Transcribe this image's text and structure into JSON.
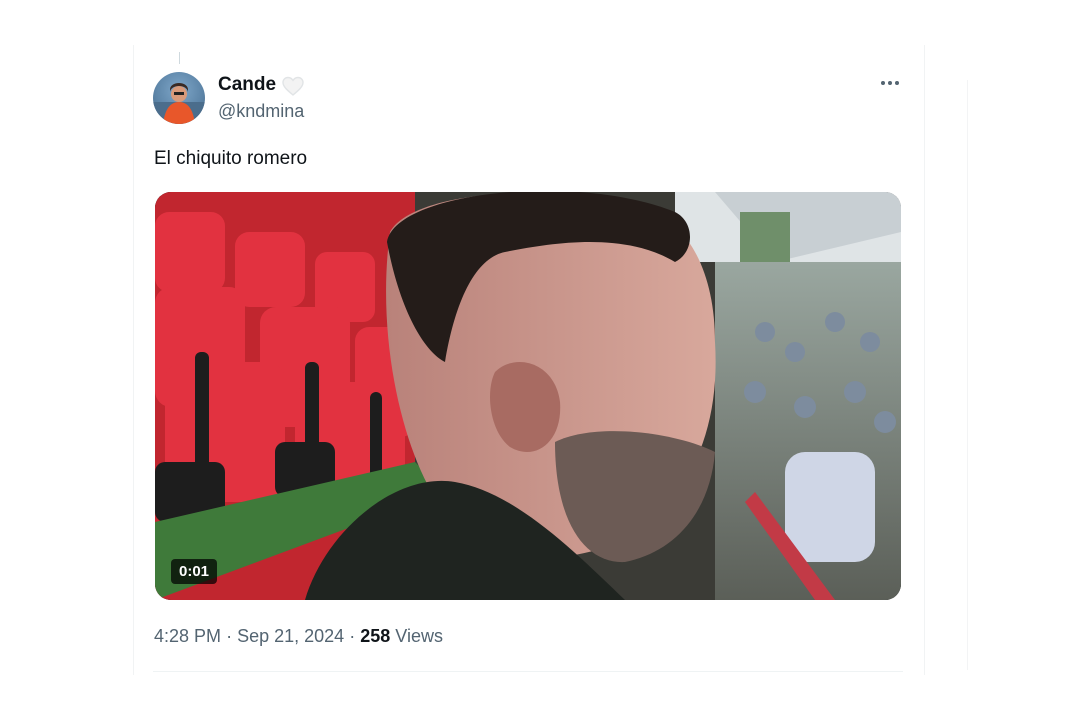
{
  "tweet": {
    "author": {
      "display_name": "Cande",
      "handle": "@kndmina"
    },
    "text": "El chiquito romero",
    "media": {
      "type": "video",
      "duration": "0:01"
    },
    "meta": {
      "time": "4:28 PM",
      "separator": "·",
      "date": "Sep 21, 2024",
      "views_count": "258",
      "views_label": "Views"
    }
  },
  "icons": {
    "heart": "heart-outline-icon",
    "more": "more-dots-icon"
  },
  "colors": {
    "text_primary": "#0f1419",
    "text_secondary": "#536471",
    "divider": "#eff3f4"
  }
}
